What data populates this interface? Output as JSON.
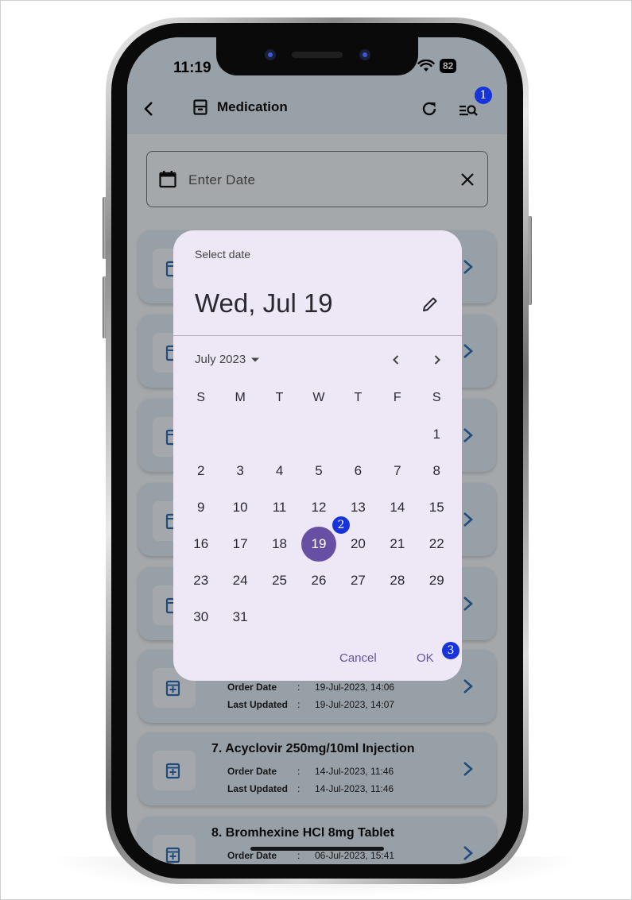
{
  "status_bar": {
    "time": "11:19",
    "battery": "82"
  },
  "app_bar": {
    "title": "Medication"
  },
  "search": {
    "placeholder": "Enter Date"
  },
  "orders": [
    {
      "name": "7. Acyclovir 250mg/10ml Injection",
      "order_date_label": "Order Date",
      "order_date": "14-Jul-2023, 11:46",
      "updated_label": "Last Updated",
      "updated": "14-Jul-2023, 11:46"
    },
    {
      "name": "8. Bromhexine HCl 8mg Tablet",
      "order_date_label": "Order Date",
      "order_date": "06-Jul-2023, 15:41"
    }
  ],
  "partial_order": {
    "order_date_label": "Order Date",
    "order_date": "19-Jul-2023, 14:06",
    "updated_label": "Last Updated",
    "updated": "19-Jul-2023, 14:07"
  },
  "separator": ":",
  "date_picker": {
    "label": "Select date",
    "selected_display": "Wed, Jul 19",
    "month_year": "July 2023",
    "weekdays": [
      "S",
      "M",
      "T",
      "W",
      "T",
      "F",
      "S"
    ],
    "days": [
      "",
      "",
      "",
      "",
      "",
      "",
      "1",
      "2",
      "3",
      "4",
      "5",
      "6",
      "7",
      "8",
      "9",
      "10",
      "11",
      "12",
      "13",
      "14",
      "15",
      "16",
      "17",
      "18",
      "19",
      "20",
      "21",
      "22",
      "23",
      "24",
      "25",
      "26",
      "27",
      "28",
      "29",
      "30",
      "31"
    ],
    "selected_day": "19",
    "cancel_label": "Cancel",
    "ok_label": "OK"
  },
  "annotations": [
    "1",
    "2",
    "3"
  ],
  "colors": {
    "accent": "#6750a4",
    "dialog_bg": "#ede7f6",
    "badge": "#1634d9",
    "app_bar_bg": "#dde9f3",
    "icon_blue": "#2f6fb5"
  }
}
